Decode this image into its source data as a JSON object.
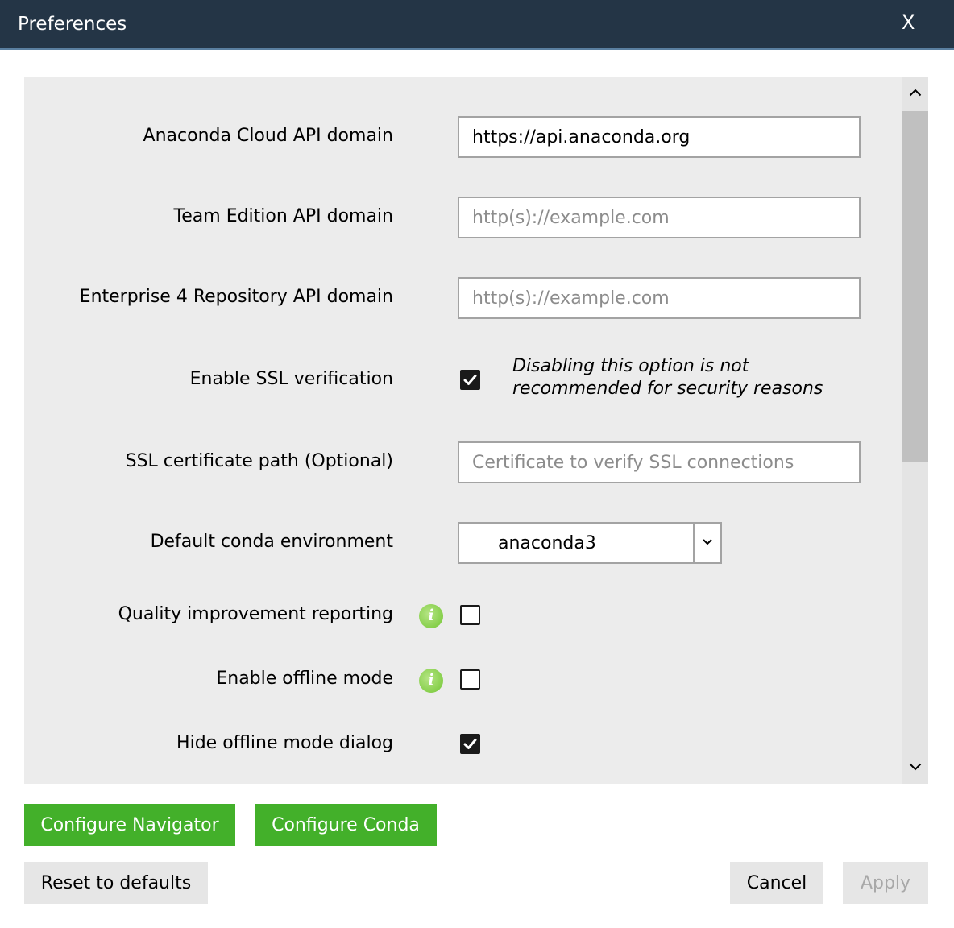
{
  "window": {
    "title": "Preferences",
    "close_label": "X"
  },
  "fields": {
    "cloud_api": {
      "label": "Anaconda Cloud API domain",
      "value": "https://api.anaconda.org"
    },
    "team_api": {
      "label": "Team Edition API domain",
      "placeholder": "http(s)://example.com"
    },
    "enterprise_api": {
      "label": "Enterprise 4 Repository API domain",
      "placeholder": "http(s)://example.com"
    },
    "ssl_verify": {
      "label": "Enable SSL verification",
      "checked": true,
      "note_line1": "Disabling this option is not",
      "note_line2": "recommended for security reasons"
    },
    "ssl_cert": {
      "label": "SSL certificate path (Optional)",
      "placeholder": "Certificate to verify SSL connections"
    },
    "default_env": {
      "label": "Default conda environment",
      "value": "anaconda3"
    },
    "quality_reporting": {
      "label": "Quality improvement reporting",
      "info_icon": "i",
      "checked": false
    },
    "offline_mode": {
      "label": "Enable offline mode",
      "info_icon": "i",
      "checked": false
    },
    "hide_offline_dialog": {
      "label": "Hide offline mode dialog",
      "checked": true
    }
  },
  "buttons": {
    "configure_navigator": "Configure Navigator",
    "configure_conda": "Configure Conda",
    "reset": "Reset to defaults",
    "cancel": "Cancel",
    "apply": "Apply"
  },
  "colors": {
    "titlebar": "#243546",
    "accent_green": "#43b02a",
    "panel": "#ececec",
    "info_green": "#86cf4b"
  }
}
